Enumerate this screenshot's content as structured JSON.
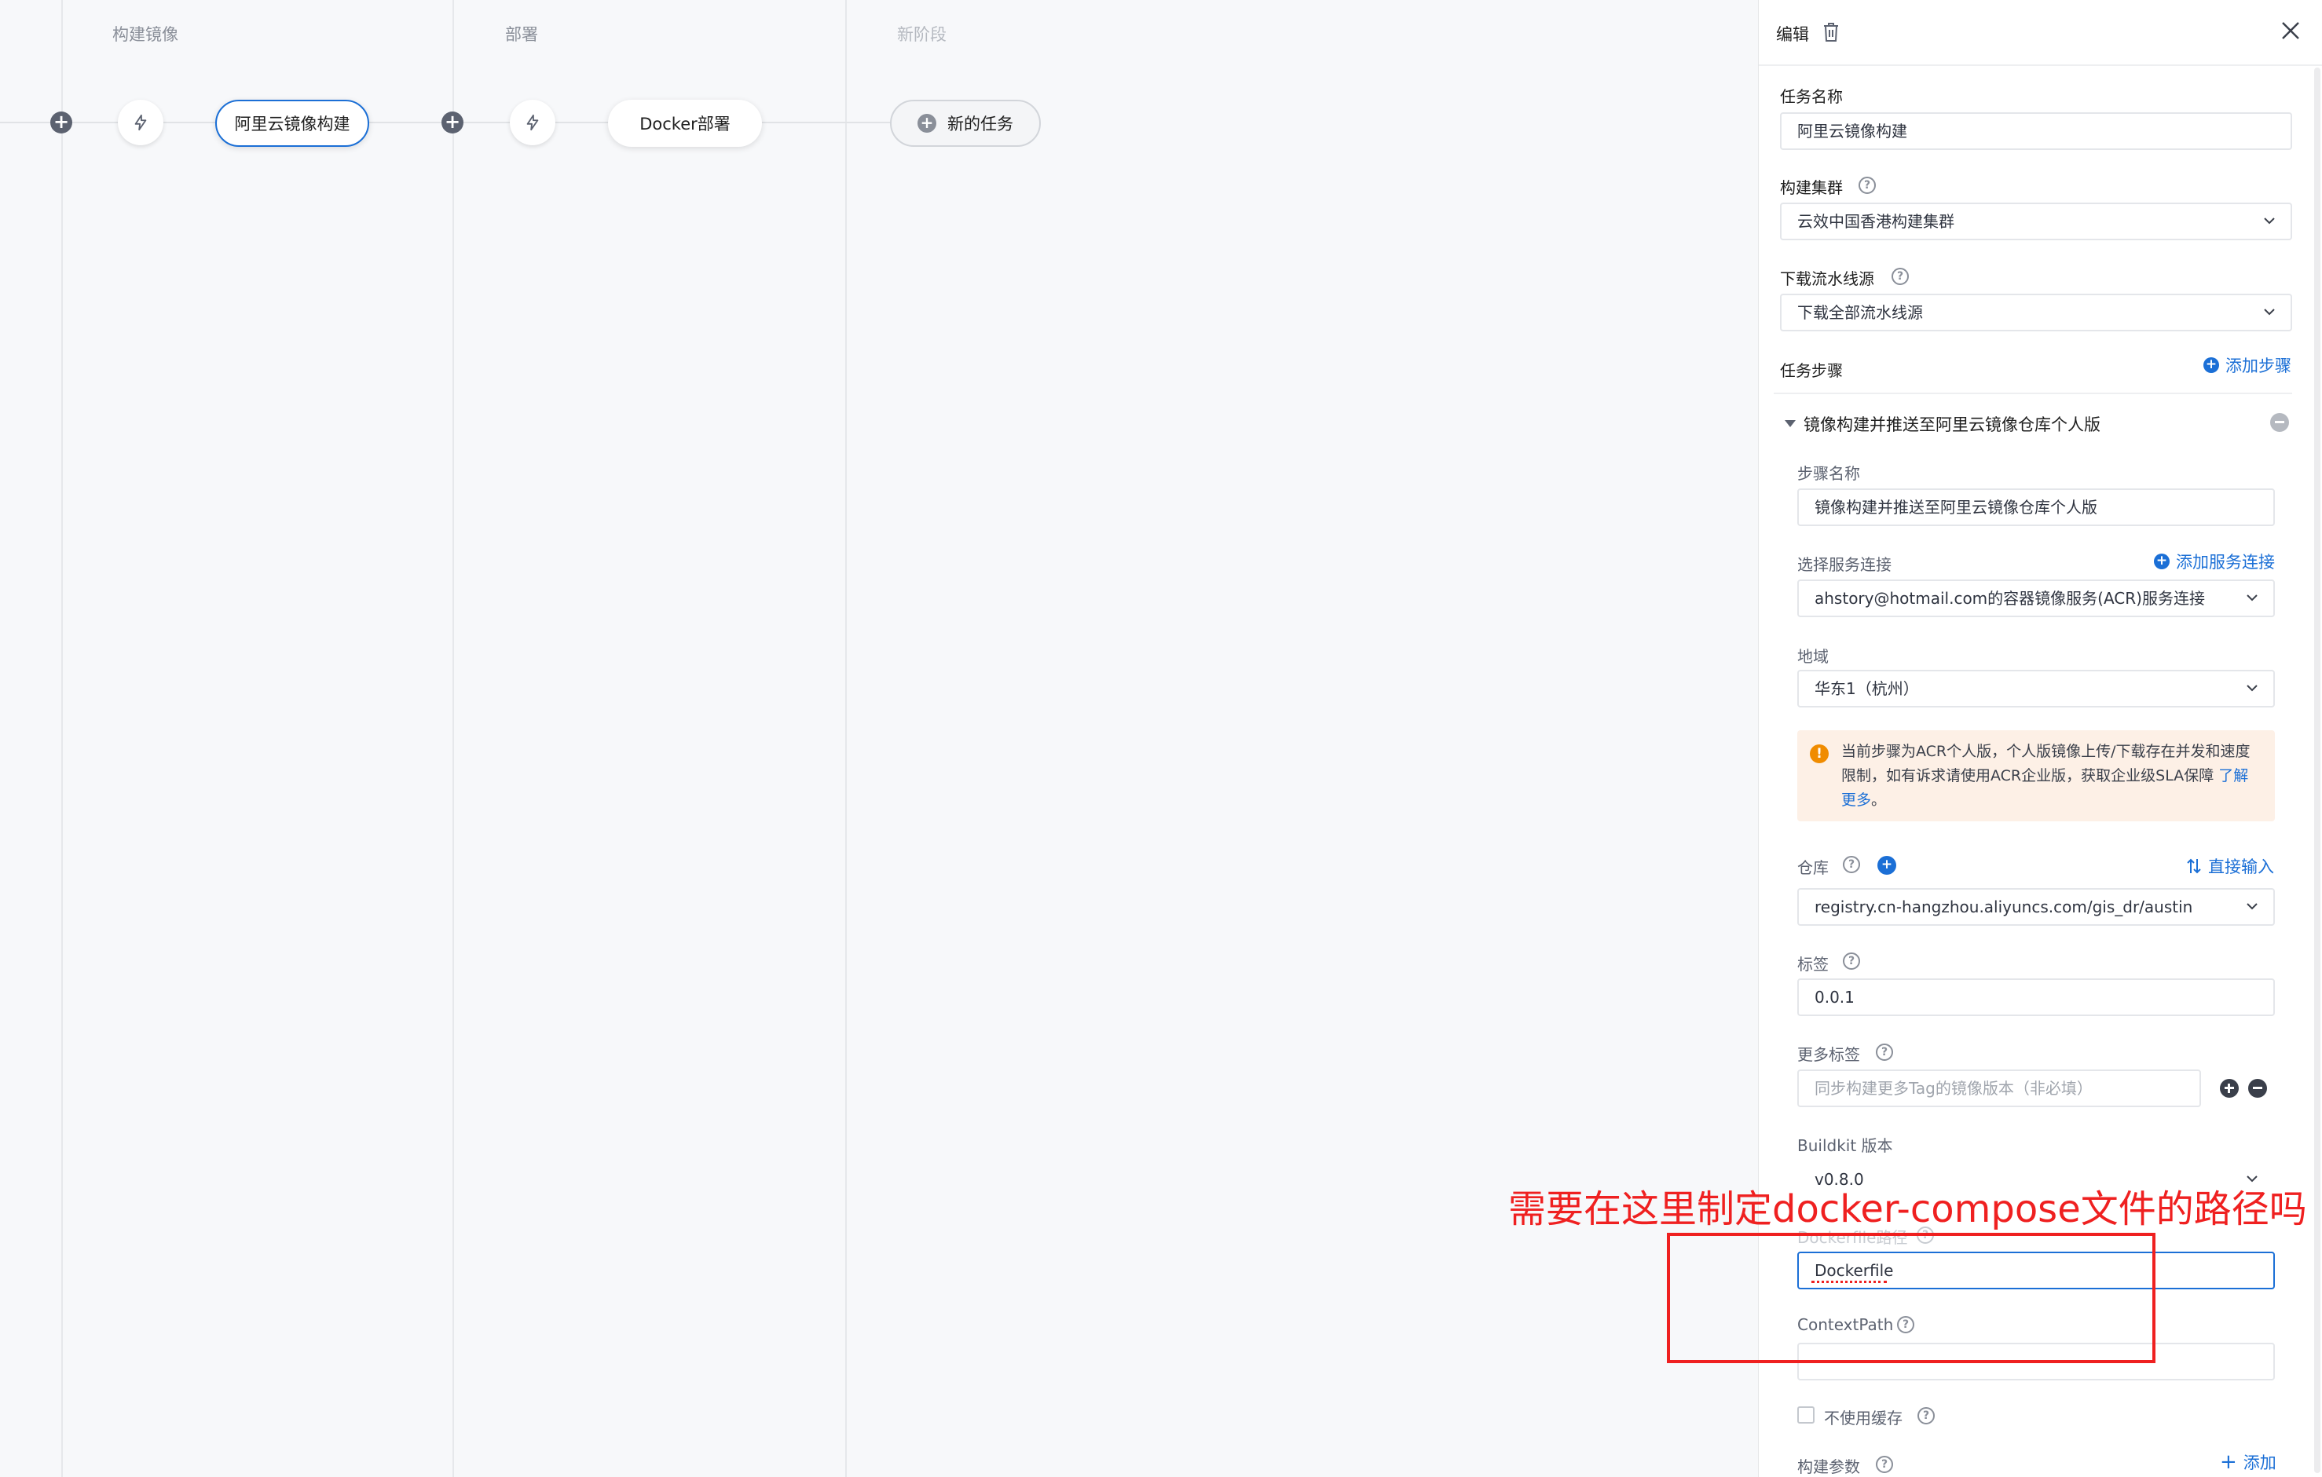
{
  "stages": [
    {
      "title": "构建镜像",
      "tasks": [
        "阿里云镜像构建"
      ]
    },
    {
      "title": "部署",
      "tasks": [
        "Docker部署"
      ]
    },
    {
      "title": "新阶段",
      "new_task_label": "新的任务"
    }
  ],
  "panel": {
    "header_title": "编辑",
    "task_name_label": "任务名称",
    "task_name_value": "阿里云镜像构建",
    "cluster_label": "构建集群",
    "cluster_value": "云效中国香港构建集群",
    "source_label": "下载流水线源",
    "source_value": "下载全部流水线源",
    "steps_label": "任务步骤",
    "add_step_label": "添加步骤",
    "step": {
      "title": "镜像构建并推送至阿里云镜像仓库个人版",
      "name_label": "步骤名称",
      "name_value": "镜像构建并推送至阿里云镜像仓库个人版",
      "service_label": "选择服务连接",
      "add_service_label": "添加服务连接",
      "service_value": "ahstory@hotmail.com的容器镜像服务(ACR)服务连接",
      "region_label": "地域",
      "region_value": "华东1（杭州）",
      "warning_text": "当前步骤为ACR个人版，个人版镜像上传/下载存在并发和速度限制，如有诉求请使用ACR企业版，获取企业级SLA保障 ",
      "warning_link": "了解更多",
      "warning_tail": "。",
      "repo_label": "仓库",
      "direct_input_label": "直接输入",
      "repo_value": "registry.cn-hangzhou.aliyuncs.com/gis_dr/austin",
      "tag_label": "标签",
      "tag_value": "0.0.1",
      "more_tags_label": "更多标签",
      "more_tags_placeholder": "同步构建更多Tag的镜像版本（非必填）",
      "buildkit_label": "Buildkit 版本",
      "buildkit_value": "v0.8.0",
      "dockerfile_label": "Dockerfile路径",
      "dockerfile_value": "Dockerfile",
      "context_label": "ContextPath",
      "context_value": "",
      "no_cache_label": "不使用缓存",
      "build_args_label": "构建参数",
      "add_label": "添加"
    }
  },
  "annotation": {
    "text": "需要在这里制定docker-compose文件的路径吗",
    "color": "#ef2020"
  },
  "colors": {
    "accent": "#1b6fd6",
    "warning": "#f08c00",
    "warning_bg": "#fdf0e6"
  }
}
